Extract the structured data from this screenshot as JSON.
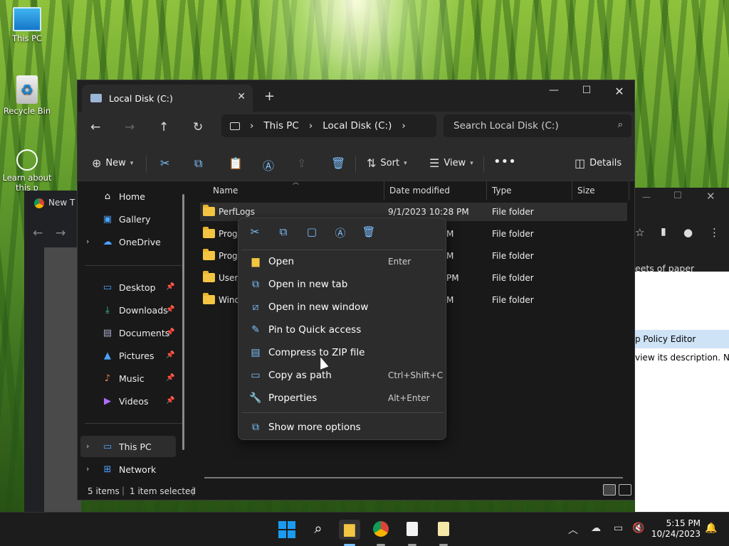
{
  "desktop": {
    "icons": [
      {
        "label": "This PC"
      },
      {
        "label": "Recycle Bin"
      },
      {
        "label": "Learn about this picture",
        "visible_label": "Learn about this p"
      }
    ]
  },
  "background_windows": {
    "chrome_tab": "New T",
    "right_texts": [
      "eets of paper",
      "p Policy Editor",
      "view its description.",
      "N"
    ]
  },
  "explorer": {
    "tab_title": "Local Disk (C:)",
    "breadcrumb": [
      "This PC",
      "Local Disk (C:)"
    ],
    "search_placeholder": "Search Local Disk (C:)",
    "commands": {
      "new": "New",
      "sort": "Sort",
      "view": "View",
      "details": "Details"
    },
    "sidebar": {
      "top": [
        {
          "label": "Home"
        },
        {
          "label": "Gallery"
        },
        {
          "label": "OneDrive"
        }
      ],
      "pinned": [
        {
          "label": "Desktop"
        },
        {
          "label": "Downloads"
        },
        {
          "label": "Documents"
        },
        {
          "label": "Pictures"
        },
        {
          "label": "Music"
        },
        {
          "label": "Videos"
        }
      ],
      "bottom": [
        {
          "label": "This PC"
        },
        {
          "label": "Network"
        }
      ]
    },
    "columns": [
      "Name",
      "Date modified",
      "Type",
      "Size"
    ],
    "rows": [
      {
        "name": "PerfLogs",
        "date": "9/1/2023 10:28 PM",
        "type": "File folder",
        "selected": true
      },
      {
        "name": "Progr",
        "date": "M",
        "type": "File folder",
        "selected": false
      },
      {
        "name": "Progr",
        "date": "M",
        "type": "File folder",
        "selected": false
      },
      {
        "name": "Users",
        "date": "PM",
        "type": "File folder",
        "selected": false
      },
      {
        "name": "Wind",
        "date": "M",
        "type": "File folder",
        "selected": false
      }
    ],
    "status": {
      "count": "5 items",
      "selected": "1 item selected"
    }
  },
  "context_menu": {
    "items": [
      {
        "label": "Open",
        "shortcut": "Enter",
        "icon": "folder-open-icon"
      },
      {
        "label": "Open in new tab",
        "shortcut": "",
        "icon": "new-tab-icon"
      },
      {
        "label": "Open in new window",
        "shortcut": "",
        "icon": "new-window-icon"
      },
      {
        "label": "Pin to Quick access",
        "shortcut": "",
        "icon": "pin-icon"
      },
      {
        "label": "Compress to ZIP file",
        "shortcut": "",
        "icon": "zip-icon"
      },
      {
        "label": "Copy as path",
        "shortcut": "Ctrl+Shift+C",
        "icon": "copy-path-icon"
      },
      {
        "label": "Properties",
        "shortcut": "Alt+Enter",
        "icon": "wrench-icon"
      }
    ],
    "more": "Show more options"
  },
  "taskbar": {
    "time": "5:15 PM",
    "date": "10/24/2023"
  },
  "colors": {
    "accent": "#7cc1ff",
    "folder": "#f4c542",
    "taskbar": "#1c1c1c"
  }
}
